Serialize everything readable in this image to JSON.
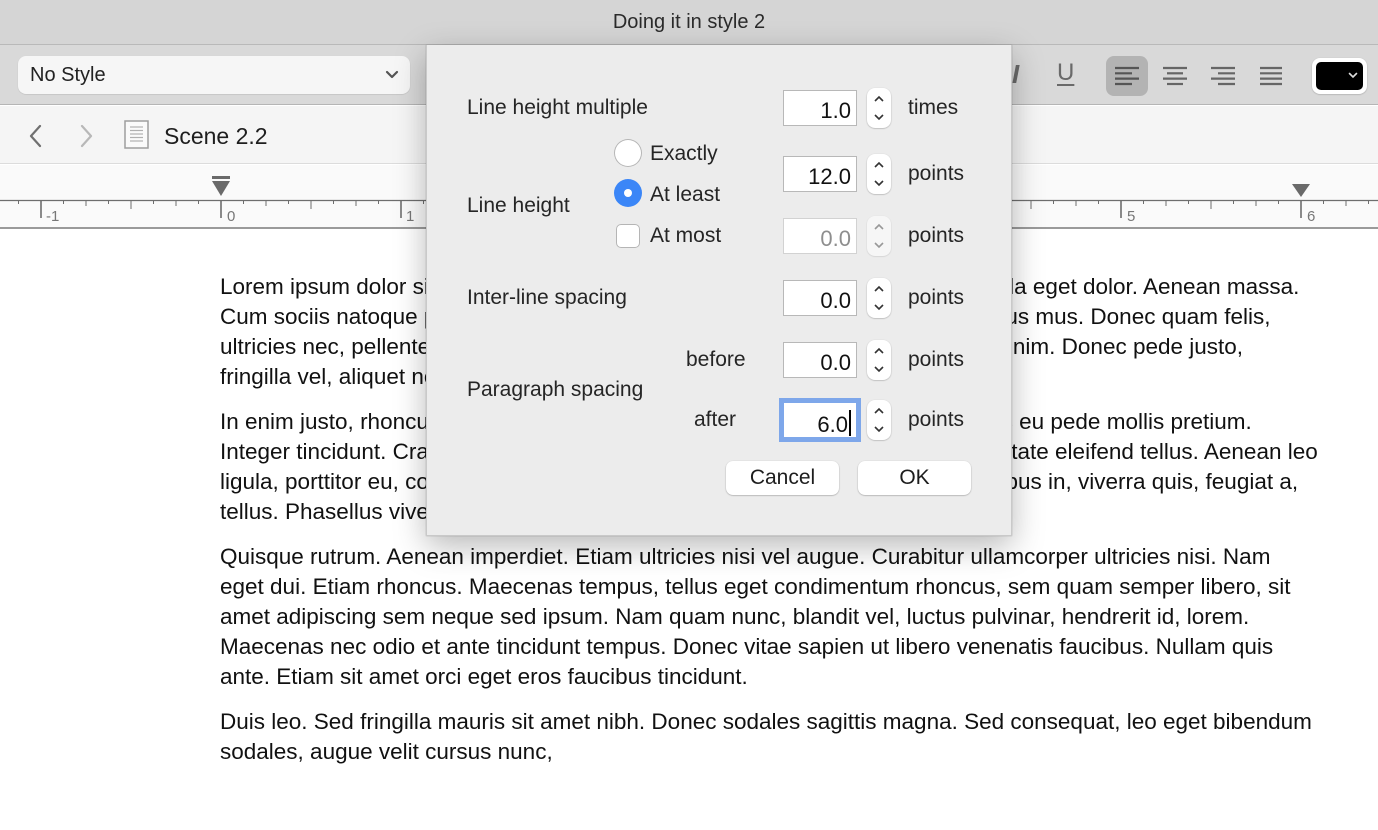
{
  "window": {
    "title": "Doing it in style 2"
  },
  "toolbar": {
    "style_select": {
      "value": "No Style"
    },
    "italic_label": "I",
    "underline_label": "U",
    "alignment": {
      "options": [
        "left",
        "center",
        "right",
        "justify"
      ],
      "selected": "left"
    },
    "text_color": "#000000"
  },
  "navbar": {
    "title": "Scene 2.2"
  },
  "ruler": {
    "labels": [
      "-1",
      "0",
      "1",
      "5",
      "6"
    ]
  },
  "document": {
    "paragraphs": [
      "Lorem ipsum dolor sit amet, consectetuer adipiscing elit. Aenean commodo ligula eget dolor. Aenean massa. Cum sociis natoque penatibus et magnis dis parturient montes, nascetur ridiculus mus. Donec quam felis, ultricies nec, pellentesque eu, pretium quis, sem. Nulla consequat massa quis enim. Donec pede justo, fringilla vel, aliquet nec, vulputate eget, arcu.",
      "In enim justo, rhoncus ut, imperdiet a, venenatis vitae, justo. Nullam dictum felis eu pede mollis pretium. Integer tincidunt. Cras dapibus. Vivamus elementum semper nisi. Aenean vulputate eleifend tellus. Aenean leo ligula, porttitor eu, consequat vitae, eleifend ac, enim. Aliquam lorem ante, dapibus in, viverra quis, feugiat a, tellus. Phasellus viverra nulla ut metus varius laoreet.",
      "Quisque rutrum. Aenean imperdiet. Etiam ultricies nisi vel augue. Curabitur ullamcorper ultricies nisi. Nam eget dui. Etiam rhoncus. Maecenas tempus, tellus eget condimentum rhoncus, sem quam semper libero, sit amet adipiscing sem neque sed ipsum. Nam quam nunc, blandit vel, luctus pulvinar, hendrerit id, lorem. Maecenas nec odio et ante tincidunt tempus. Donec vitae sapien ut libero venenatis faucibus. Nullam quis ante. Etiam sit amet orci eget eros faucibus tincidunt.",
      "Duis leo. Sed fringilla mauris sit amet nibh. Donec sodales sagittis magna. Sed consequat, leo eget bibendum sodales, augue velit cursus nunc,"
    ]
  },
  "dialog": {
    "line_height_multiple": {
      "label": "Line height multiple",
      "value": "1.0",
      "unit": "times"
    },
    "line_height": {
      "label": "Line height",
      "exactly_label": "Exactly",
      "at_least_label": "At least",
      "at_most_label": "At most",
      "selected": "At least",
      "at_most_checked": false,
      "value": "12.0",
      "unit": "points",
      "at_most_value": "0.0",
      "at_most_unit": "points"
    },
    "inter_line_spacing": {
      "label": "Inter-line spacing",
      "value": "0.0",
      "unit": "points"
    },
    "paragraph_spacing": {
      "label": "Paragraph spacing",
      "before_label": "before",
      "before_value": "0.0",
      "before_unit": "points",
      "after_label": "after",
      "after_value": "6.0",
      "after_unit": "points"
    },
    "cancel_label": "Cancel",
    "ok_label": "OK"
  }
}
